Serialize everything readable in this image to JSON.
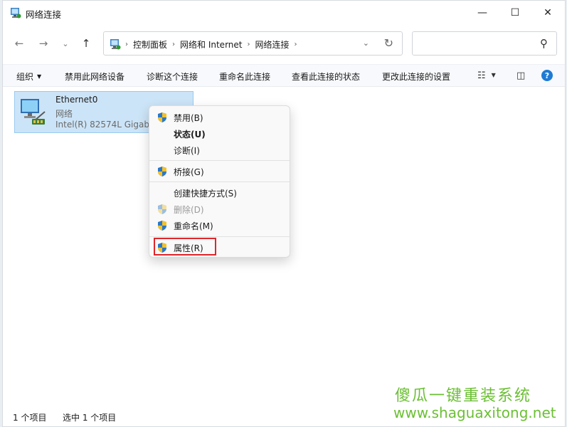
{
  "window": {
    "title": "网络连接",
    "controls": {
      "minimize": "—",
      "maximize": "☐",
      "close": "✕"
    }
  },
  "nav": {
    "back": "←",
    "forward": "→",
    "recent": "⌄",
    "up": "↑"
  },
  "address": {
    "crumbs": [
      "控制面板",
      "网络和 Internet",
      "网络连接"
    ],
    "separator": "›",
    "dropdown": "⌄",
    "refresh": "↻"
  },
  "search": {
    "placeholder": "",
    "icon": "⚲"
  },
  "commands": {
    "organize": "组织",
    "disable_device": "禁用此网络设备",
    "diagnose": "诊断这个连接",
    "rename": "重命名此连接",
    "view_status": "查看此连接的状态",
    "change_settings": "更改此连接的设置",
    "help": "?"
  },
  "item": {
    "name": "Ethernet0",
    "type": "网络",
    "device": "Intel(R) 82574L Gigabit Network Connection"
  },
  "context_menu": {
    "items": [
      {
        "label": "禁用(B)"
      },
      {
        "label": "状态(U)"
      },
      {
        "label": "诊断(I)"
      },
      {
        "label": "桥接(G)"
      },
      {
        "label": "创建快捷方式(S)"
      },
      {
        "label": "删除(D)"
      },
      {
        "label": "重命名(M)"
      },
      {
        "label": "属性(R)"
      }
    ]
  },
  "status": {
    "count": "1 个项目",
    "selected": "选中 1 个项目"
  },
  "watermark": {
    "title": "傻瓜一键重装系统",
    "url": "www.shaguaxitong.net"
  },
  "colors": {
    "accent": "#1f7ad6",
    "selection": "#cce4f7",
    "highlight_box": "#e0262b",
    "watermark": "#6cbf35"
  }
}
